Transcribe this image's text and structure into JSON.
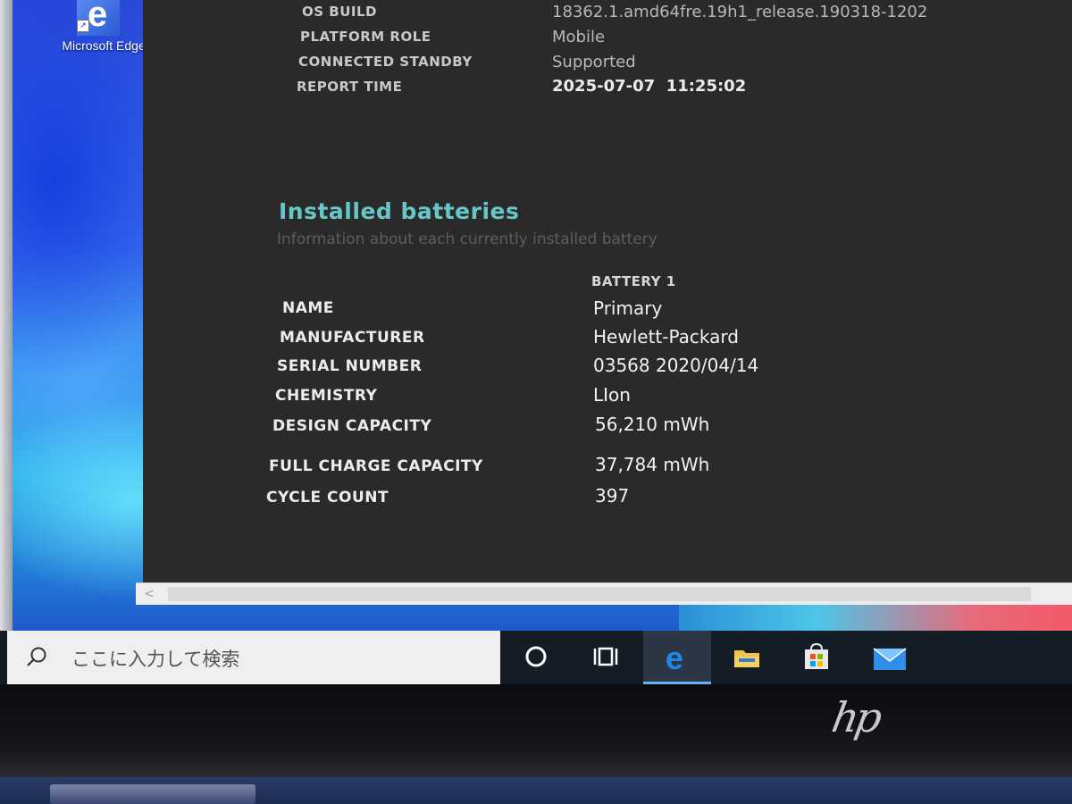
{
  "desktop": {
    "icon_label": "Microsoft Edge",
    "icon_glyph": "e"
  },
  "system_info": {
    "rows": [
      {
        "key": "OS BUILD",
        "value": "18362.1.amd64fre.19h1_release.190318-1202"
      },
      {
        "key": "PLATFORM ROLE",
        "value": "Mobile"
      },
      {
        "key": "CONNECTED STANDBY",
        "value": "Supported"
      },
      {
        "key": "REPORT TIME",
        "value": "2025-07-07  11:25:02"
      }
    ]
  },
  "installed_batteries": {
    "title": "Installed batteries",
    "subtitle": "Information about each currently installed battery",
    "column_header": "BATTERY 1",
    "rows": [
      {
        "key": "NAME",
        "value": "Primary"
      },
      {
        "key": "MANUFACTURER",
        "value": "Hewlett-Packard"
      },
      {
        "key": "SERIAL NUMBER",
        "value": "03568 2020/04/14"
      },
      {
        "key": "CHEMISTRY",
        "value": "LIon"
      },
      {
        "key": "DESIGN CAPACITY",
        "value": "56,210 mWh"
      },
      {
        "key": "FULL CHARGE CAPACITY",
        "value": "37,784 mWh"
      },
      {
        "key": "CYCLE COUNT",
        "value": "397"
      }
    ]
  },
  "scrollbar": {
    "left_arrow": "<"
  },
  "taskbar": {
    "search_placeholder": "ここに入力して検索",
    "buttons": [
      "cortana-icon",
      "task-view-icon",
      "edge-icon",
      "file-explorer-icon",
      "store-icon",
      "mail-icon"
    ],
    "active_button": "edge-icon"
  },
  "hardware": {
    "brand_logo": "hp"
  },
  "colors": {
    "section_title": "#66c6c8",
    "report_bg": "#2a2a2b",
    "taskbar_bg": "#141c26",
    "active_indicator": "#6ab0f0"
  }
}
